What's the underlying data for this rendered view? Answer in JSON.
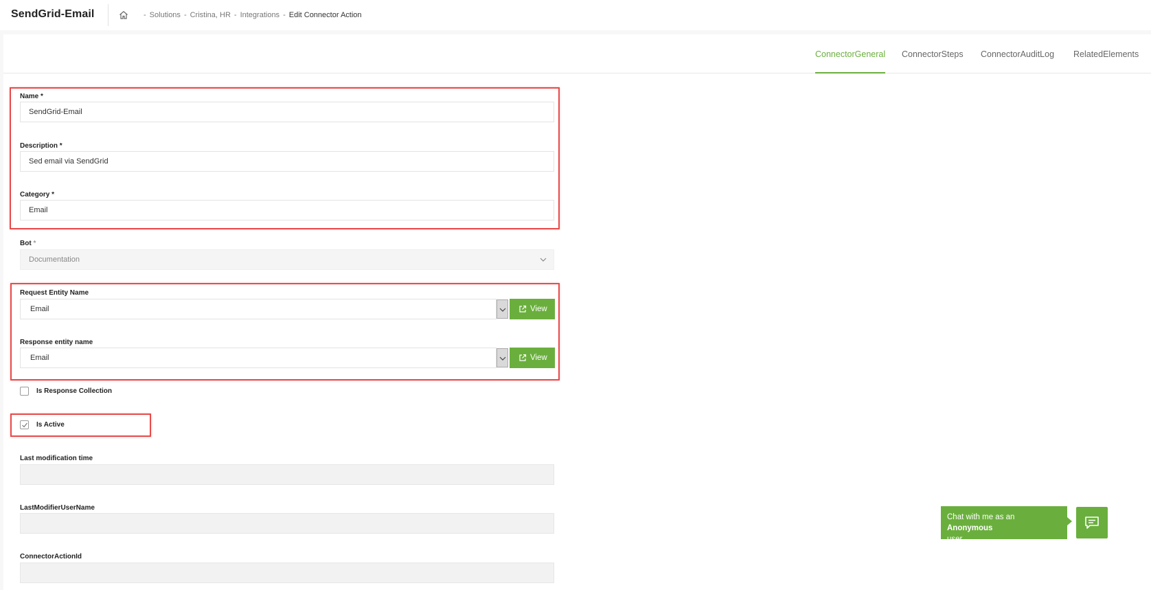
{
  "header": {
    "app_title": "SendGrid-Email",
    "breadcrumb": {
      "sep": "-",
      "items": [
        "Solutions",
        "Cristina, HR",
        "Integrations"
      ],
      "current": "Edit Connector Action"
    }
  },
  "tabs": [
    {
      "label": "ConnectorGeneral",
      "active": true
    },
    {
      "label": "ConnectorSteps",
      "active": false
    },
    {
      "label": "ConnectorAuditLog",
      "active": false
    },
    {
      "label": "RelatedElements",
      "active": false
    }
  ],
  "form": {
    "name": {
      "label": "Name",
      "required": "*",
      "value": "SendGrid-Email"
    },
    "description": {
      "label": "Description",
      "required": "*",
      "value": "Sed email via SendGrid"
    },
    "category": {
      "label": "Category",
      "required": "*",
      "value": "Email"
    },
    "bot": {
      "label": "Bot",
      "required": "*",
      "value": "Documentation"
    },
    "request_entity": {
      "label": "Request Entity Name",
      "value": "Email",
      "view_label": "View"
    },
    "response_entity": {
      "label": "Response entity name",
      "value": "Email",
      "view_label": "View"
    },
    "is_response_collection": {
      "label": "Is Response Collection",
      "checked": false
    },
    "is_active": {
      "label": "Is Active",
      "checked": true
    },
    "last_modification_time": {
      "label": "Last modification time",
      "value": ""
    },
    "last_modifier_user_name": {
      "label": "LastModifierUserName",
      "value": ""
    },
    "connector_action_id": {
      "label": "ConnectorActionId",
      "value": ""
    }
  },
  "chat": {
    "prefix": "Chat with me as an ",
    "role": "Anonymous",
    "suffix": "user"
  },
  "colors": {
    "accent": "#6aaf3d",
    "highlight": "#e84a4a"
  },
  "icons": {
    "home": "home-icon",
    "bot_dropdown": "chevron-down-icon",
    "view": "external-link-icon",
    "checkbox": "checkmark-icon",
    "chat": "chat-icon"
  }
}
